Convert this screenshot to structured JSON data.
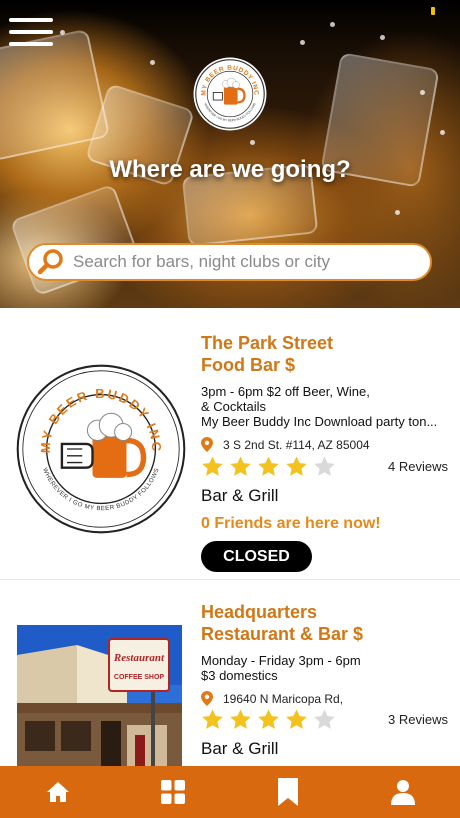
{
  "hero": {
    "title": "Where are we going?",
    "search_placeholder": "Search for bars, night clubs or city"
  },
  "logo": {
    "top_text": "MY BEER BUDDY INC",
    "bottom_text": "WHEREVER I GO MY BEER BUDDY FOLLOWS"
  },
  "listings": [
    {
      "name": "The Park Street Food Bar $",
      "name_line1": "The Park Street",
      "name_line2": "Food Bar $",
      "deal_line1": "3pm - 6pm $2 off Beer, Wine,",
      "deal_line2": "& Cocktails",
      "deal_line3": "My Beer Buddy Inc Download party ton...",
      "address": "3 S 2nd St. #114, AZ 85004",
      "rating": 4,
      "reviews": "4 Reviews",
      "category": "Bar & Grill",
      "friends": "0 Friends are here now!",
      "status": "CLOSED"
    },
    {
      "name": "Headquarters Restaurant & Bar $",
      "name_line1": "Headquarters",
      "name_line2": "Restaurant & Bar $",
      "deal_line1": "Monday - Friday 3pm - 6pm",
      "deal_line2": "$3 domestics",
      "address": "19640 N Maricopa Rd,",
      "rating": 4,
      "reviews": "3 Reviews",
      "category": "Bar & Grill",
      "sign_line1": "Restaurant",
      "sign_line2": "COFFEE SHOP"
    }
  ],
  "nav": {
    "items": [
      "home-icon",
      "grid-icon",
      "bookmark-icon",
      "profile-icon"
    ]
  },
  "colors": {
    "accent": "#d27716",
    "nav_bar": "#d9690f",
    "friends_text": "#e48a1c",
    "star_filled": "#f4c21f",
    "star_empty": "#d9d9d9"
  }
}
